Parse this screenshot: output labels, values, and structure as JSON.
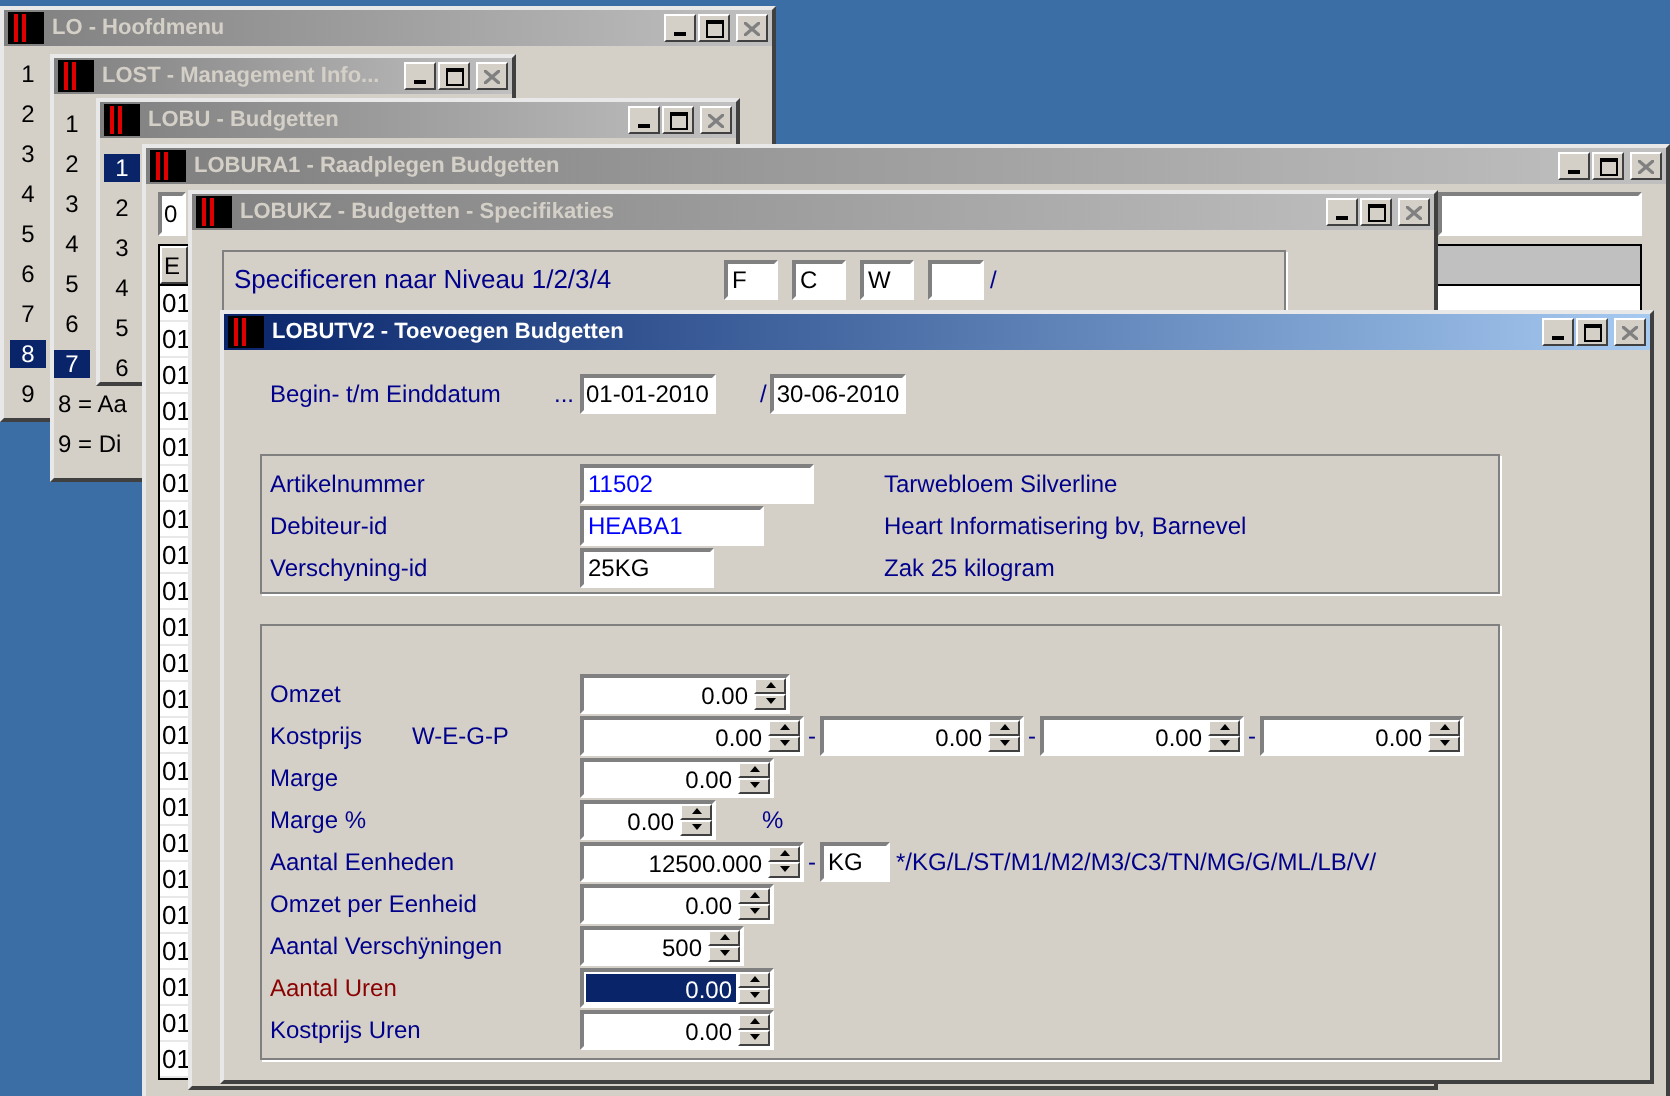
{
  "windows": [
    {
      "kind": "menu",
      "title": "LO - Hoofdmenu",
      "active": false,
      "items": [
        {
          "label": "1",
          "selected": false
        },
        {
          "label": "2",
          "selected": false
        },
        {
          "label": "3",
          "selected": false
        },
        {
          "label": "4",
          "selected": false
        },
        {
          "label": "5",
          "selected": false
        },
        {
          "label": "6",
          "selected": false
        },
        {
          "label": "7",
          "selected": false
        },
        {
          "label": "8",
          "selected": true
        },
        {
          "label": "9",
          "selected": false
        }
      ]
    },
    {
      "kind": "menu",
      "title": "LOST - Management Info...",
      "active": false,
      "items": [
        {
          "label": "1",
          "selected": false
        },
        {
          "label": "2",
          "selected": false
        },
        {
          "label": "3",
          "selected": false
        },
        {
          "label": "4",
          "selected": false
        },
        {
          "label": "5",
          "selected": false
        },
        {
          "label": "6",
          "selected": false
        },
        {
          "label": "7",
          "selected": true
        },
        {
          "label": "8 = Aa",
          "selected": false
        },
        {
          "label": "9 = Di",
          "selected": false
        }
      ]
    },
    {
      "kind": "menu",
      "title": "LOBU - Budgetten",
      "active": false,
      "items": [
        {
          "label": "1",
          "selected": true
        },
        {
          "label": "2",
          "selected": false
        },
        {
          "label": "3",
          "selected": false
        },
        {
          "label": "4",
          "selected": false
        },
        {
          "label": "5",
          "selected": false
        },
        {
          "label": "6",
          "selected": false
        }
      ]
    },
    {
      "kind": "table",
      "title": "LOBURA1 - Raadplegen Budgetten",
      "active": false,
      "field": "0",
      "header": "E",
      "rows": [
        "01",
        "01",
        "01",
        "01",
        "01",
        "01",
        "01",
        "01",
        "01",
        "01",
        "01",
        "01",
        "01",
        "01",
        "01",
        "01",
        "01",
        "01",
        "01",
        "01",
        "01",
        "01"
      ]
    },
    {
      "kind": "spec",
      "title": "LOBUKZ - Budgetten - Specifikaties",
      "active": false,
      "label": "Specificeren naar Niveau 1/2/3/4",
      "fields": [
        "F",
        "C",
        "W"
      ],
      "separator": "/"
    },
    {
      "kind": "form",
      "title": "LOBUTV2 - Toevoegen Budgetten",
      "active": true
    }
  ],
  "form": {
    "date": {
      "label": "Begin- t/m Einddatum",
      "lookup": "...",
      "from": "01-01-2010",
      "separator": "/",
      "to": "30-06-2010"
    },
    "identity": [
      {
        "kind": "key",
        "label": "Artikelnummer",
        "value": "11502",
        "description": "Tarwebloem Silverline"
      },
      {
        "kind": "key",
        "label": "Debiteur-id",
        "value": "HEABA1",
        "description": "Heart Informatisering bv, Barnevel"
      },
      {
        "kind": "plain",
        "label": "Verschyning-id",
        "value": "25KG",
        "description": "Zak 25 kilogram"
      }
    ],
    "amounts": [
      {
        "kind": "spin",
        "label": "Omzet",
        "value": "0.00",
        "focused": false
      },
      {
        "kind": "multi",
        "label": "Kostprijs",
        "sublabel": "W-E-G-P",
        "values": [
          "0.00",
          "0.00",
          "0.00",
          "0.00"
        ],
        "separators": [
          "-",
          "-",
          "-"
        ],
        "focused": false
      },
      {
        "kind": "spin",
        "label": "Marge",
        "value": "0.00",
        "focused": false
      },
      {
        "kind": "suffix",
        "label": "Marge %",
        "value": "0.00",
        "suffix": "%",
        "focused": false
      },
      {
        "kind": "unit",
        "label": "Aantal Eenheden",
        "value": "12500.000",
        "separator": "-",
        "unit": "KG",
        "hint": "*/KG/L/ST/M1/M2/M3/C3/TN/MG/G/ML/LB/V/",
        "focused": false
      },
      {
        "kind": "spin",
        "label": "Omzet per Eenheid",
        "value": "0.00",
        "focused": false
      },
      {
        "kind": "spin",
        "label": "Aantal Verschÿningen",
        "value": "500",
        "focused": false
      },
      {
        "kind": "spin",
        "label": "Aantal Uren",
        "value": "0.00",
        "focused": true
      },
      {
        "kind": "spin",
        "label": "Kostprijs Uren",
        "value": "0.00",
        "focused": false
      }
    ]
  }
}
